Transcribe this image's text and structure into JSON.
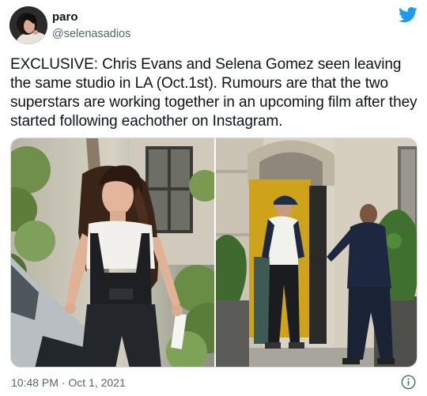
{
  "tweet": {
    "author": {
      "display_name": "paro",
      "handle": "@selenasadios"
    },
    "text": "EXCLUSIVE: Chris Evans and Selena Gomez seen leaving the same studio in LA (Oct.1st). Rumours are that the two superstars are working together in an upcoming film after they started following eachother on Instagram.",
    "timestamp": "10:48 PM · Oct 1, 2021",
    "media": [
      {
        "kind": "photo",
        "subject": "woman-in-overalls"
      },
      {
        "kind": "photo",
        "subject": "men-at-yellow-door"
      }
    ]
  },
  "icons": {
    "brand": "twitter-bird-icon",
    "info": "info-icon"
  },
  "colors": {
    "brand_blue": "#1d9bf0",
    "text_primary": "#0f1419",
    "text_secondary": "#536471",
    "border": "#cfd9de"
  }
}
